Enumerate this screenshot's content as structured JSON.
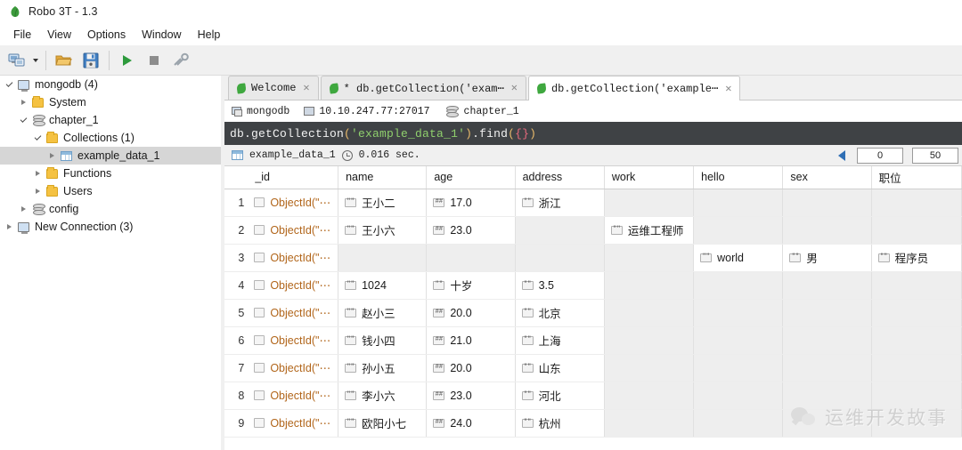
{
  "window": {
    "title": "Robo 3T - 1.3",
    "app_icon": "leaf-icon"
  },
  "menubar": {
    "items": [
      "File",
      "View",
      "Options",
      "Window",
      "Help"
    ]
  },
  "toolbar": {
    "buttons": [
      {
        "name": "connect-button",
        "icon": "computers-icon",
        "label": "Connect"
      },
      {
        "name": "connect-dropdown",
        "icon": "chevron-down-icon",
        "label": ""
      },
      {
        "name": "open-script-button",
        "icon": "open-folder-icon",
        "label": "Open Script"
      },
      {
        "name": "save-script-button",
        "icon": "floppy-disk-icon",
        "label": "Save Script"
      },
      {
        "name": "execute-button",
        "icon": "play-icon",
        "label": "Execute"
      },
      {
        "name": "stop-button",
        "icon": "stop-square-icon",
        "label": "Stop"
      },
      {
        "name": "explain-button",
        "icon": "wrench-icon",
        "label": "Explain"
      }
    ]
  },
  "sidebar": {
    "items": [
      {
        "label": "mongodb (4)",
        "icon": "computer-icon",
        "indent": 0,
        "twisty": "expanded",
        "selected": false
      },
      {
        "label": "System",
        "icon": "folder-icon",
        "indent": 1,
        "twisty": "collapsed",
        "selected": false
      },
      {
        "label": "chapter_1",
        "icon": "database-icon",
        "indent": 1,
        "twisty": "expanded",
        "selected": false
      },
      {
        "label": "Collections (1)",
        "icon": "folder-icon",
        "indent": 2,
        "twisty": "expanded",
        "selected": false
      },
      {
        "label": "example_data_1",
        "icon": "collection-icon",
        "indent": 3,
        "twisty": "collapsed",
        "selected": true
      },
      {
        "label": "Functions",
        "icon": "folder-icon",
        "indent": 2,
        "twisty": "collapsed",
        "selected": false
      },
      {
        "label": "Users",
        "icon": "folder-icon",
        "indent": 2,
        "twisty": "collapsed",
        "selected": false
      },
      {
        "label": "config",
        "icon": "database-icon",
        "indent": 1,
        "twisty": "collapsed",
        "selected": false
      },
      {
        "label": "New Connection (3)",
        "icon": "computer-icon",
        "indent": 0,
        "twisty": "collapsed",
        "selected": false
      }
    ]
  },
  "tabs": [
    {
      "label": "Welcome",
      "active": false,
      "modified": false
    },
    {
      "label": "* db.getCollection('exam⋯",
      "active": false,
      "modified": true
    },
    {
      "label": "db.getCollection('example⋯",
      "active": true,
      "modified": false
    }
  ],
  "connection_info": {
    "connection": "mongodb",
    "host": "10.10.247.77:27017",
    "database": "chapter_1"
  },
  "editor": {
    "query_plain": "db.getCollection('example_data_1').find({})",
    "parts": {
      "prefix": "db.getCollection",
      "open_paren": "(",
      "string": "'example_data_1'",
      "close_paren": ")",
      "method": ".find",
      "open_paren2": "(",
      "braces": "{}",
      "close_paren2": ")"
    }
  },
  "result": {
    "collection": "example_data_1",
    "time": "0.016 sec.",
    "paging": {
      "skip": "0",
      "limit": "50"
    },
    "columns": [
      "_id",
      "name",
      "age",
      "address",
      "work",
      "hello",
      "sex",
      "职位"
    ],
    "rows": [
      {
        "n": "1",
        "_id": "ObjectId(\"⋯",
        "name": {
          "t": "str",
          "v": "王小二"
        },
        "age": {
          "t": "num",
          "v": "17.0"
        },
        "address": {
          "t": "str",
          "v": "浙江"
        },
        "work": null,
        "hello": null,
        "sex": null,
        "job": null
      },
      {
        "n": "2",
        "_id": "ObjectId(\"⋯",
        "name": {
          "t": "str",
          "v": "王小六"
        },
        "age": {
          "t": "num",
          "v": "23.0"
        },
        "address": null,
        "work": {
          "t": "str",
          "v": "运维工程师"
        },
        "hello": null,
        "sex": null,
        "job": null
      },
      {
        "n": "3",
        "_id": "ObjectId(\"⋯",
        "name": null,
        "age": null,
        "address": null,
        "work": null,
        "hello": {
          "t": "str",
          "v": "world"
        },
        "sex": {
          "t": "str",
          "v": "男"
        },
        "job": {
          "t": "str",
          "v": "程序员"
        }
      },
      {
        "n": "4",
        "_id": "ObjectId(\"⋯",
        "name": {
          "t": "str",
          "v": "1024"
        },
        "age": {
          "t": "str",
          "v": "十岁"
        },
        "address": {
          "t": "str",
          "v": "3.5"
        },
        "work": null,
        "hello": null,
        "sex": null,
        "job": null
      },
      {
        "n": "5",
        "_id": "ObjectId(\"⋯",
        "name": {
          "t": "str",
          "v": "赵小三"
        },
        "age": {
          "t": "num",
          "v": "20.0"
        },
        "address": {
          "t": "str",
          "v": "北京"
        },
        "work": null,
        "hello": null,
        "sex": null,
        "job": null
      },
      {
        "n": "6",
        "_id": "ObjectId(\"⋯",
        "name": {
          "t": "str",
          "v": "钱小四"
        },
        "age": {
          "t": "num",
          "v": "21.0"
        },
        "address": {
          "t": "str",
          "v": "上海"
        },
        "work": null,
        "hello": null,
        "sex": null,
        "job": null
      },
      {
        "n": "7",
        "_id": "ObjectId(\"⋯",
        "name": {
          "t": "str",
          "v": "孙小五"
        },
        "age": {
          "t": "num",
          "v": "20.0"
        },
        "address": {
          "t": "str",
          "v": "山东"
        },
        "work": null,
        "hello": null,
        "sex": null,
        "job": null
      },
      {
        "n": "8",
        "_id": "ObjectId(\"⋯",
        "name": {
          "t": "str",
          "v": "李小六"
        },
        "age": {
          "t": "num",
          "v": "23.0"
        },
        "address": {
          "t": "str",
          "v": "河北"
        },
        "work": null,
        "hello": null,
        "sex": null,
        "job": null
      },
      {
        "n": "9",
        "_id": "ObjectId(\"⋯",
        "name": {
          "t": "str",
          "v": "欧阳小七"
        },
        "age": {
          "t": "num",
          "v": "24.0"
        },
        "address": {
          "t": "str",
          "v": "杭州"
        },
        "work": null,
        "hello": null,
        "sex": null,
        "job": null
      }
    ]
  },
  "watermark": {
    "text": "运维开发故事",
    "logo": "wechat-icon"
  },
  "colors": {
    "editor_bg": "#3f4245",
    "string_green": "#8fcf6d",
    "paren_orange": "#e8b96b",
    "brace_pink": "#e86a7d",
    "objectid_orange": "#b1651a",
    "selection_gray": "#d6d6d6"
  }
}
